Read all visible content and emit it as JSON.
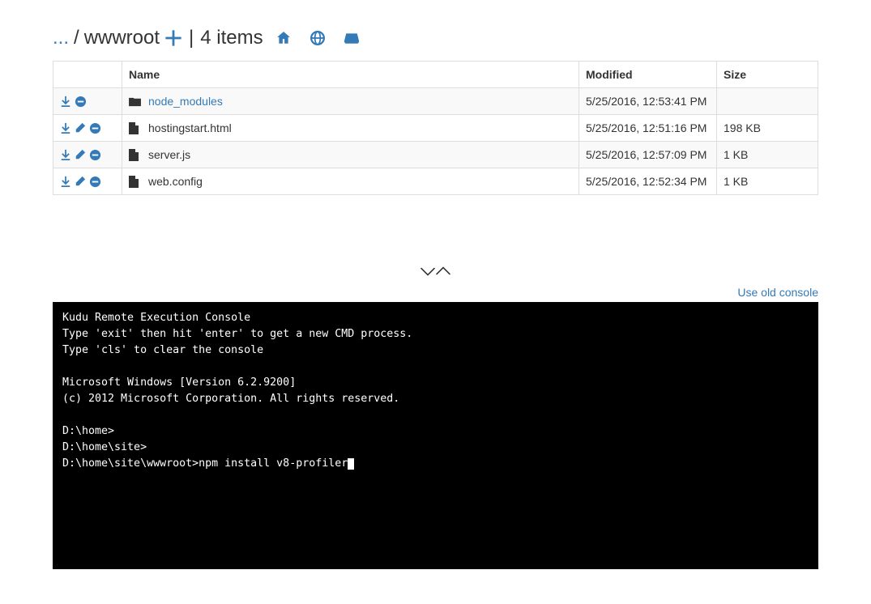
{
  "breadcrumb": {
    "ellipsis": "...",
    "sep": "/",
    "current": "wwwroot",
    "divider": "|",
    "count_label": "4 items"
  },
  "columns": {
    "name": "Name",
    "modified": "Modified",
    "size": "Size"
  },
  "rows": [
    {
      "type": "folder",
      "name": "node_modules",
      "modified": "5/25/2016, 12:53:41 PM",
      "size": ""
    },
    {
      "type": "file",
      "name": "hostingstart.html",
      "modified": "5/25/2016, 12:51:16 PM",
      "size": "198 KB"
    },
    {
      "type": "file",
      "name": "server.js",
      "modified": "5/25/2016, 12:57:09 PM",
      "size": "1 KB"
    },
    {
      "type": "file",
      "name": "web.config",
      "modified": "5/25/2016, 12:52:34 PM",
      "size": "1 KB"
    }
  ],
  "old_console_link": "Use old console",
  "console": {
    "lines": [
      "Kudu Remote Execution Console",
      "Type 'exit' then hit 'enter' to get a new CMD process.",
      "Type 'cls' to clear the console",
      "",
      "Microsoft Windows [Version 6.2.9200]",
      "(c) 2012 Microsoft Corporation. All rights reserved.",
      "",
      "D:\\home>",
      "D:\\home\\site>"
    ],
    "prompt": "D:\\home\\site\\wwwroot>",
    "input": "npm install v8-profiler"
  }
}
